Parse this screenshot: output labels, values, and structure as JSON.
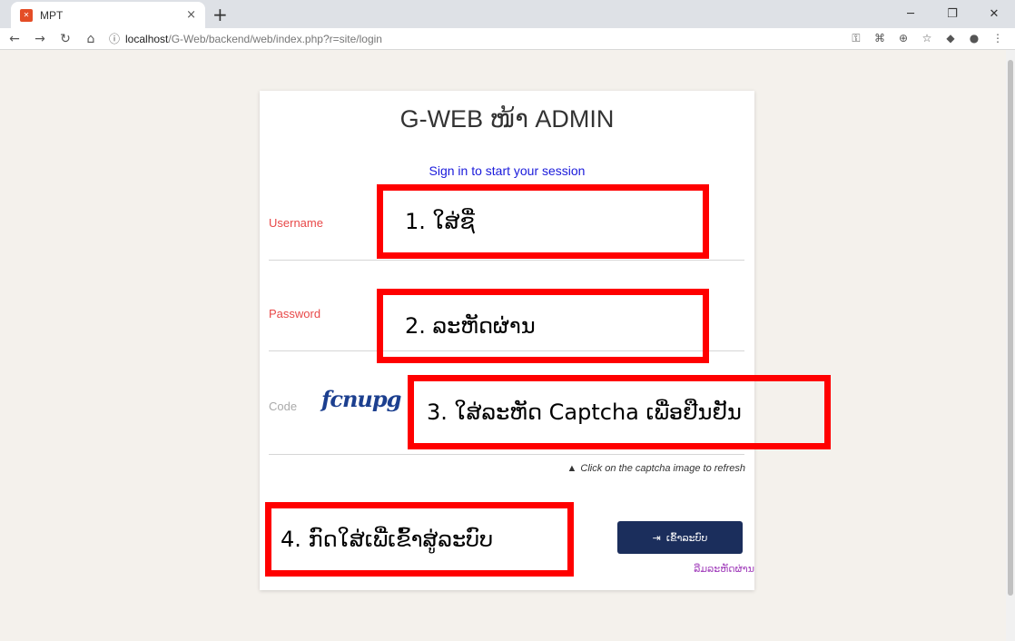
{
  "browser": {
    "tab_title": "MPT",
    "tab_close": "×",
    "new_tab": "+",
    "url_host": "localhost",
    "url_path": "/G-Web/backend/web/index.php?r=site/login"
  },
  "login": {
    "title": "G-WEB ໜ້າ ADMIN",
    "subtitle": "Sign in to start your session",
    "username_label": "Username",
    "password_label": "Password",
    "code_label": "Code",
    "captcha_text": "fcnupg",
    "refresh_hint": "Click on the captcha image to refresh",
    "login_button": "ເຂົ້າລະບົບ",
    "forgot_password": "ລືມລະຫັດຜ່ານ"
  },
  "annotations": {
    "step1": "1.  ໃສ່ຊື່",
    "step2": "2.  ລະຫັດຜ່ານ",
    "step3": "3.  ໃສ່ລະຫັດ Captcha ເພື່ອຢືນຢັນ",
    "step4": "4.  ກົດໃສ່ເພື່ເຂົ້າສູ່ລະບົບ"
  },
  "colors": {
    "annotation_border": "#ff0000",
    "button_bg": "#1b2e5c",
    "label_red": "#e84848",
    "subtitle_blue": "#1a1adb",
    "link_purple": "#a03cba"
  },
  "icons": {
    "login_button_icon": "sign-in-icon",
    "refresh_hint_icon": "warning-icon"
  }
}
